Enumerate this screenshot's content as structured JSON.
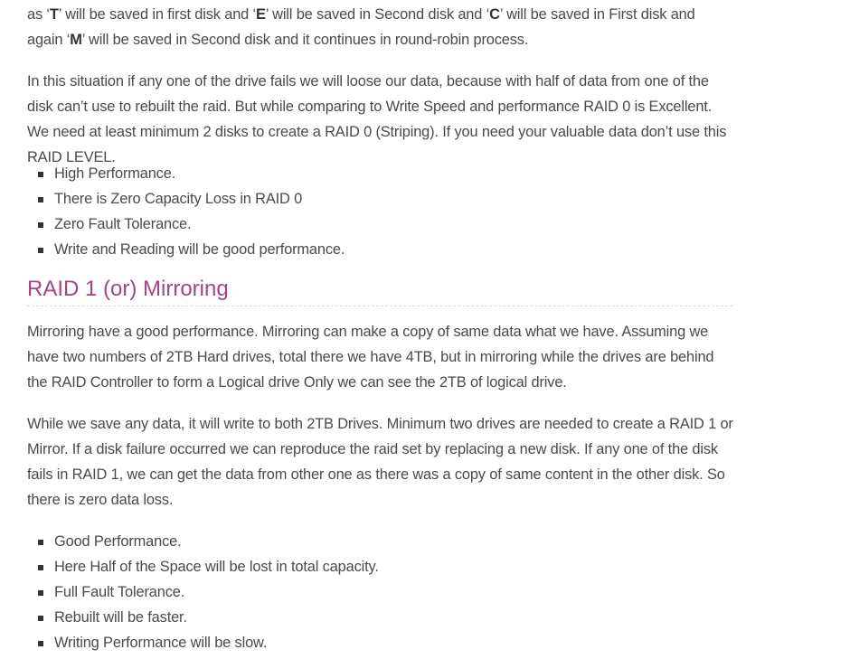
{
  "intro_paragraph": {
    "s1": "as ‘",
    "b1": "T",
    "s2": "’ will be saved in first disk and ‘",
    "b2": "E",
    "s3": "’ will be saved in Second disk and ‘",
    "b3": "C",
    "s4": "’ will be saved in First disk and again ‘",
    "b4": "M",
    "s5": "’ will be saved in Second disk and it continues in round-robin process."
  },
  "raid0_paragraph": "In this situation if any one of the drive fails we will loose our data, because with half of data from one of the disk can’t use to rebuilt the raid. But while comparing to Write Speed and performance RAID 0 is Excellent. We need at least minimum 2 disks to create a RAID 0 (Striping). If you need your valuable data don’t use this RAID LEVEL.",
  "raid0_list": [
    "High Performance.",
    "There is Zero Capacity Loss in RAID 0",
    "Zero Fault Tolerance.",
    "Write and Reading will be good performance."
  ],
  "raid1_heading": "RAID 1 (or) Mirroring",
  "raid1_paragraph_1": "Mirroring have a good performance. Mirroring can make a copy of same data what we have. Assuming we have two numbers of 2TB Hard drives, total there we have 4TB, but in mirroring while the drives are behind the RAID Controller to form a Logical drive Only we can see the 2TB of logical drive.",
  "raid1_paragraph_2": "While we save any data, it will write to both 2TB Drives. Minimum two drives are needed to create a RAID 1 or Mirror. If a disk failure occurred we can reproduce the raid set by replacing a new disk. If any one of the disk fails in RAID 1, we can get the data from other one as there was a copy of same content in the other disk. So there is zero data loss.",
  "raid1_list": [
    "Good Performance.",
    "Here Half of the Space will be lost in total capacity.",
    "Full Fault Tolerance.",
    "Rebuilt will be faster.",
    "Writing Performance will be slow."
  ],
  "colors": {
    "heading": "#a24586",
    "text": "#4a4a4a",
    "bullet": "#333333"
  }
}
